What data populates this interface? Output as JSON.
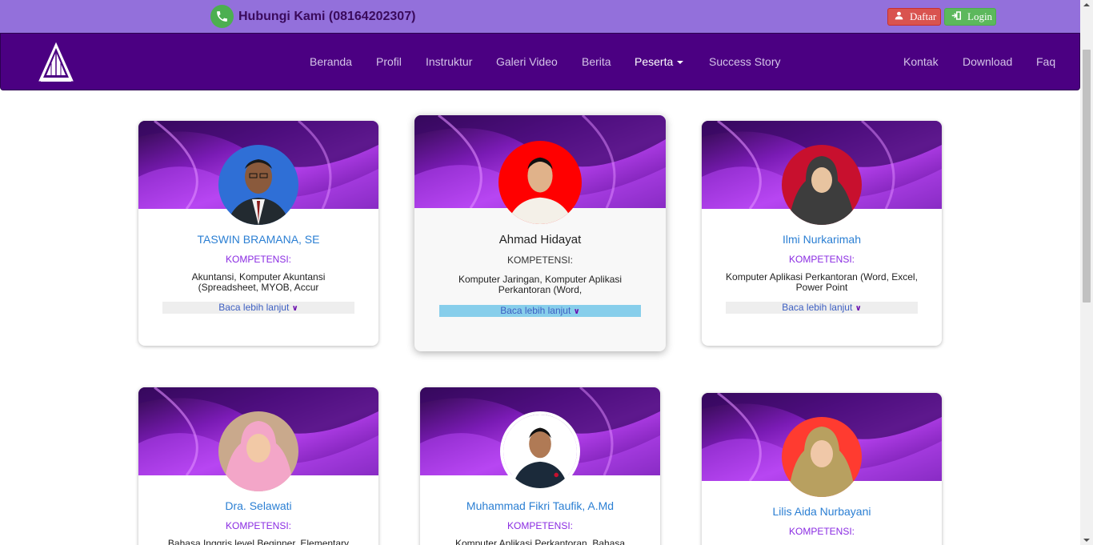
{
  "topbar": {
    "contact_label": "Hubungi Kami (08164202307)",
    "phone_icon": "phone-icon",
    "daftar_label": "Daftar",
    "login_label": "Login"
  },
  "nav": {
    "items": [
      "Beranda",
      "Profil",
      "Instruktur",
      "Galeri Video",
      "Berita",
      "Peserta",
      "Success Story",
      "Kontak",
      "Download",
      "Faq"
    ],
    "active": "Peserta"
  },
  "colors": {
    "topbar": "#9370db",
    "navbar": "#4b0082",
    "name_link": "#2b7fd3",
    "kompetensi": "#8a2be2"
  },
  "cards": [
    {
      "name": "TASWIN BRAMANA, SE",
      "kompetensi": "KOMPETENSI:",
      "desc_line1": "Akuntansi, Komputer Akuntansi",
      "desc_line2": "(Spreadsheet, MYOB, Accur",
      "more": "Baca lebih lanjut"
    },
    {
      "name": "Ahmad Hidayat",
      "kompetensi": "KOMPETENSI:",
      "desc_line1": "Komputer Jaringan, Komputer Aplikasi",
      "desc_line2": "Perkantoran (Word,",
      "more": "Baca lebih lanjut"
    },
    {
      "name": "Ilmi Nurkarimah",
      "kompetensi": "KOMPETENSI:",
      "desc_line1": "Komputer Aplikasi Perkantoran (Word, Excel,",
      "desc_line2": "Power Point",
      "more": "Baca lebih lanjut"
    },
    {
      "name": "Dra. Selawati",
      "kompetensi": "KOMPETENSI:",
      "desc_line1": "Bahasa Inggris level Beginner, Elementary"
    },
    {
      "name": "Muhammad Fikri Taufik, A.Md",
      "kompetensi": "KOMPETENSI:",
      "desc_line1": "Komputer Aplikasi Perkantoran, Bahasa"
    },
    {
      "name": "Lilis Aida Nurbayani",
      "kompetensi": "KOMPETENSI:"
    }
  ]
}
